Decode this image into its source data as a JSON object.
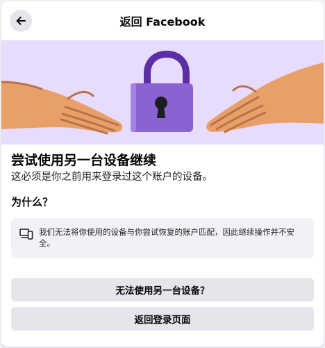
{
  "header": {
    "title": "返回 Facebook",
    "back_icon": "arrow-left-icon"
  },
  "hero": {
    "illustration": "hands-holding-padlock",
    "colors": {
      "background": "#e8dcfe",
      "lock": "#8a63d2",
      "skin": "#e8a068"
    }
  },
  "main": {
    "heading": "尝试使用另一台设备继续",
    "subheading": "这必须是你之前用来登录过这个账户的设备。",
    "why_label": "为什么？",
    "info_icon": "devices-icon",
    "info_text": "我们无法将你使用的设备与你尝试恢复的账户匹配，因此继续操作并不安全。"
  },
  "actions": {
    "cannot_use_other_device": "无法使用另一台设备？",
    "back_to_login": "返回登录页面"
  }
}
